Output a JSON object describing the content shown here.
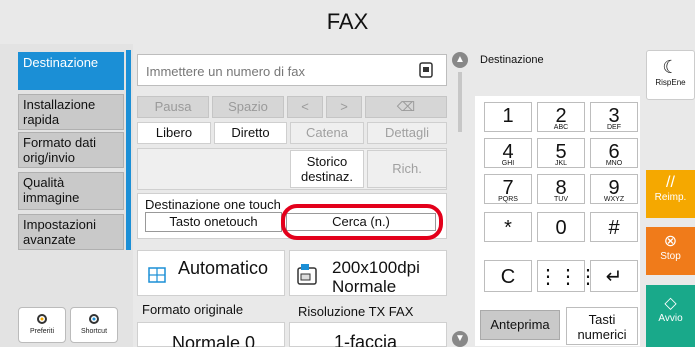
{
  "title": "FAX",
  "sidebar": {
    "items": [
      {
        "label": "Destinazione"
      },
      {
        "label": "Installazione rapida"
      },
      {
        "label": "Formato dati orig/invio"
      },
      {
        "label": "Qualità immagine"
      },
      {
        "label": "Impostazioni avanzate"
      }
    ],
    "favorites_label": "Preferiti",
    "shortcut_label": "Shortcut"
  },
  "fax_input": {
    "placeholder": "Immettere un numero di fax"
  },
  "buttons": {
    "pause": "Pausa",
    "space": "Spazio",
    "libero": "Libero",
    "diretto": "Diretto",
    "catena": "Catena",
    "dettagli": "Dettagli",
    "storico": "Storico destinaz.",
    "rich": "Rich."
  },
  "onetouch": {
    "header": "Destinazione one touch",
    "button": "Tasto onetouch",
    "search": "Cerca (n.)"
  },
  "settings": [
    {
      "value": "Automatico",
      "label": "Formato originale"
    },
    {
      "value": "200x100dpi Normale",
      "label": "Risoluzione TX FAX"
    },
    {
      "value": "Normale 0",
      "label": ""
    },
    {
      "value": "1-faccia",
      "label": ""
    }
  ],
  "keypad": {
    "header": "Destinazione",
    "keys": [
      {
        "main": "1",
        "sub": ""
      },
      {
        "main": "2",
        "sub": "ABC"
      },
      {
        "main": "3",
        "sub": "DEF"
      },
      {
        "main": "4",
        "sub": "GHI"
      },
      {
        "main": "5",
        "sub": "JKL"
      },
      {
        "main": "6",
        "sub": "MNO"
      },
      {
        "main": "7",
        "sub": "PQRS"
      },
      {
        "main": "8",
        "sub": "TUV"
      },
      {
        "main": "9",
        "sub": "WXYZ"
      },
      {
        "main": "*",
        "sub": ""
      },
      {
        "main": "0",
        "sub": ""
      },
      {
        "main": "#",
        "sub": ""
      }
    ],
    "clear": "C",
    "preview": "Anteprima",
    "numeric": "Tasti numerici"
  },
  "right_panel": {
    "rispene": "RispEne",
    "reimp": "Reimp.",
    "stop": "Stop",
    "avvio": "Avvio"
  },
  "colors": {
    "accent": "#1b8fd6",
    "reimp": "#f5a800",
    "stop": "#f07b1a",
    "avvio": "#19a98a",
    "highlight": "#e3001b"
  }
}
